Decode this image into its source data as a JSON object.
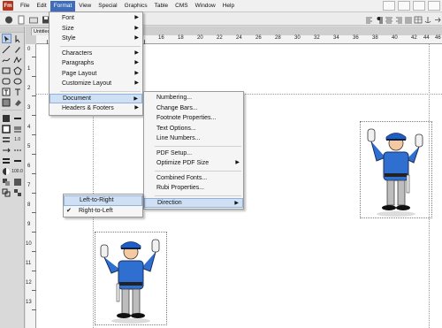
{
  "app": {
    "icon_text": "Fm"
  },
  "menubar": {
    "items": [
      {
        "label": "File"
      },
      {
        "label": "Edit"
      },
      {
        "label": "Format",
        "active": true
      },
      {
        "label": "View"
      },
      {
        "label": "Special"
      },
      {
        "label": "Graphics"
      },
      {
        "label": "Table"
      },
      {
        "label": "CMS"
      },
      {
        "label": "Window"
      },
      {
        "label": "Help"
      }
    ]
  },
  "document": {
    "tab_label": "Untitled"
  },
  "rulers": {
    "horizontal": [
      "16",
      "18",
      "20",
      "22",
      "24",
      "26",
      "28",
      "30",
      "32",
      "34",
      "36",
      "38",
      "40",
      "42",
      "44",
      "46"
    ],
    "vertical": [
      "0",
      "1",
      "2",
      "3",
      "4",
      "5",
      "6",
      "7",
      "8",
      "9",
      "10",
      "11",
      "12",
      "13"
    ]
  },
  "tools": {
    "label_a": "1.0",
    "label_b": "100.0"
  },
  "format_menu": {
    "items": [
      {
        "label": "Font",
        "submenu": true
      },
      {
        "label": "Size",
        "submenu": true
      },
      {
        "label": "Style",
        "submenu": true
      },
      {
        "label": "Characters",
        "submenu": true
      },
      {
        "label": "Paragraphs",
        "submenu": true
      },
      {
        "label": "Page Layout",
        "submenu": true
      },
      {
        "label": "Customize Layout",
        "submenu": true
      },
      {
        "label": "Document",
        "submenu": true,
        "highlighted": true
      },
      {
        "label": "Headers & Footers",
        "submenu": true
      }
    ]
  },
  "document_submenu": {
    "items": [
      {
        "label": "Numbering..."
      },
      {
        "label": "Change Bars..."
      },
      {
        "label": "Footnote Properties..."
      },
      {
        "label": "Text Options..."
      },
      {
        "label": "Line Numbers..."
      },
      {
        "label": "PDF Setup..."
      },
      {
        "label": "Optimize PDF Size",
        "submenu": true
      },
      {
        "label": "Combined Fonts..."
      },
      {
        "label": "Rubi Properties..."
      },
      {
        "label": "Direction",
        "submenu": true,
        "highlighted": true
      }
    ]
  },
  "direction_submenu": {
    "items": [
      {
        "label": "Left-to-Right",
        "highlighted": true,
        "checked": false
      },
      {
        "label": "Right-to-Left",
        "checked": true
      }
    ]
  },
  "colors": {
    "accent": "#3f6dbc",
    "highlight": "#cfe0f5",
    "uniform": "#2f6fd0"
  }
}
